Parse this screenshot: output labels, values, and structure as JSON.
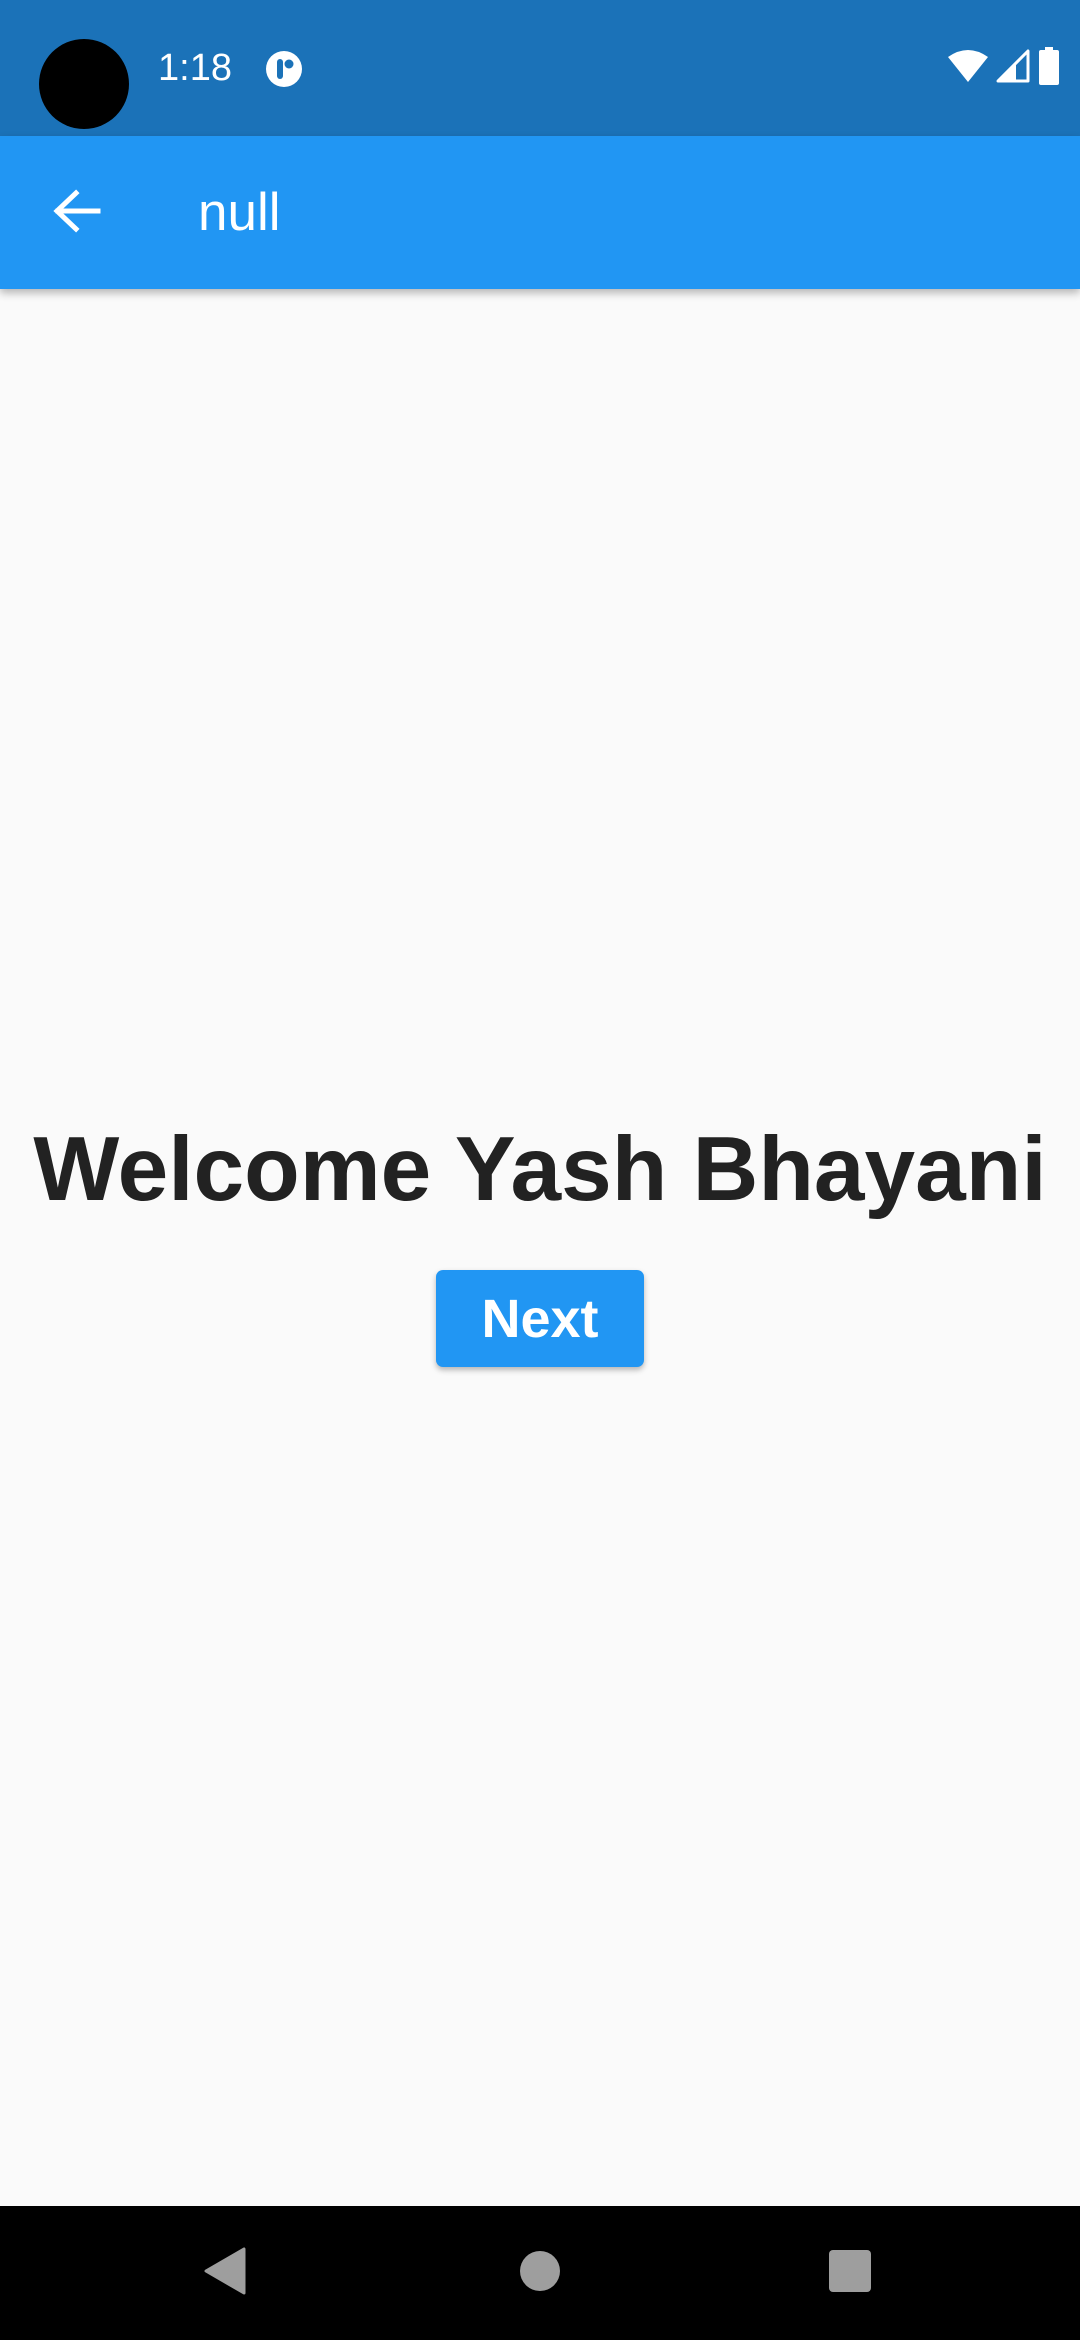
{
  "status_bar": {
    "time": "1:18",
    "icons": [
      "notification-app-icon",
      "wifi-icon",
      "cell-signal-icon",
      "battery-icon"
    ]
  },
  "app_bar": {
    "title": "null",
    "back_icon": "arrow-back-icon",
    "color": "#2196f3"
  },
  "main": {
    "welcome_text": "Welcome Yash Bhayani",
    "next_label": "Next"
  },
  "nav_bar": {
    "icons": [
      "back-triangle-icon",
      "home-circle-icon",
      "recents-square-icon"
    ]
  },
  "colors": {
    "status_bar": "#1b72b8",
    "accent": "#2196f3",
    "background": "#fafafa",
    "text": "#222222"
  }
}
